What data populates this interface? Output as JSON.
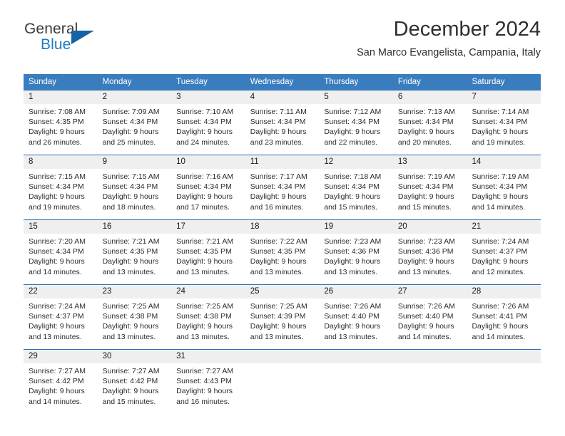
{
  "brand": {
    "name_top": "General",
    "name_bottom": "Blue",
    "accent_color": "#1464a5",
    "text_color": "#3b3b3b"
  },
  "header": {
    "title": "December 2024",
    "subtitle": "San Marco Evangelista, Campania, Italy"
  },
  "theme": {
    "header_blue": "#3a7dbf",
    "rule_blue": "#2a6db5",
    "date_band": "#efefef"
  },
  "calendar": {
    "weekdays": [
      "Sunday",
      "Monday",
      "Tuesday",
      "Wednesday",
      "Thursday",
      "Friday",
      "Saturday"
    ],
    "weeks": [
      [
        {
          "date": "1",
          "sunrise": "Sunrise: 7:08 AM",
          "sunset": "Sunset: 4:35 PM",
          "daylight1": "Daylight: 9 hours",
          "daylight2": "and 26 minutes."
        },
        {
          "date": "2",
          "sunrise": "Sunrise: 7:09 AM",
          "sunset": "Sunset: 4:34 PM",
          "daylight1": "Daylight: 9 hours",
          "daylight2": "and 25 minutes."
        },
        {
          "date": "3",
          "sunrise": "Sunrise: 7:10 AM",
          "sunset": "Sunset: 4:34 PM",
          "daylight1": "Daylight: 9 hours",
          "daylight2": "and 24 minutes."
        },
        {
          "date": "4",
          "sunrise": "Sunrise: 7:11 AM",
          "sunset": "Sunset: 4:34 PM",
          "daylight1": "Daylight: 9 hours",
          "daylight2": "and 23 minutes."
        },
        {
          "date": "5",
          "sunrise": "Sunrise: 7:12 AM",
          "sunset": "Sunset: 4:34 PM",
          "daylight1": "Daylight: 9 hours",
          "daylight2": "and 22 minutes."
        },
        {
          "date": "6",
          "sunrise": "Sunrise: 7:13 AM",
          "sunset": "Sunset: 4:34 PM",
          "daylight1": "Daylight: 9 hours",
          "daylight2": "and 20 minutes."
        },
        {
          "date": "7",
          "sunrise": "Sunrise: 7:14 AM",
          "sunset": "Sunset: 4:34 PM",
          "daylight1": "Daylight: 9 hours",
          "daylight2": "and 19 minutes."
        }
      ],
      [
        {
          "date": "8",
          "sunrise": "Sunrise: 7:15 AM",
          "sunset": "Sunset: 4:34 PM",
          "daylight1": "Daylight: 9 hours",
          "daylight2": "and 19 minutes."
        },
        {
          "date": "9",
          "sunrise": "Sunrise: 7:15 AM",
          "sunset": "Sunset: 4:34 PM",
          "daylight1": "Daylight: 9 hours",
          "daylight2": "and 18 minutes."
        },
        {
          "date": "10",
          "sunrise": "Sunrise: 7:16 AM",
          "sunset": "Sunset: 4:34 PM",
          "daylight1": "Daylight: 9 hours",
          "daylight2": "and 17 minutes."
        },
        {
          "date": "11",
          "sunrise": "Sunrise: 7:17 AM",
          "sunset": "Sunset: 4:34 PM",
          "daylight1": "Daylight: 9 hours",
          "daylight2": "and 16 minutes."
        },
        {
          "date": "12",
          "sunrise": "Sunrise: 7:18 AM",
          "sunset": "Sunset: 4:34 PM",
          "daylight1": "Daylight: 9 hours",
          "daylight2": "and 15 minutes."
        },
        {
          "date": "13",
          "sunrise": "Sunrise: 7:19 AM",
          "sunset": "Sunset: 4:34 PM",
          "daylight1": "Daylight: 9 hours",
          "daylight2": "and 15 minutes."
        },
        {
          "date": "14",
          "sunrise": "Sunrise: 7:19 AM",
          "sunset": "Sunset: 4:34 PM",
          "daylight1": "Daylight: 9 hours",
          "daylight2": "and 14 minutes."
        }
      ],
      [
        {
          "date": "15",
          "sunrise": "Sunrise: 7:20 AM",
          "sunset": "Sunset: 4:34 PM",
          "daylight1": "Daylight: 9 hours",
          "daylight2": "and 14 minutes."
        },
        {
          "date": "16",
          "sunrise": "Sunrise: 7:21 AM",
          "sunset": "Sunset: 4:35 PM",
          "daylight1": "Daylight: 9 hours",
          "daylight2": "and 13 minutes."
        },
        {
          "date": "17",
          "sunrise": "Sunrise: 7:21 AM",
          "sunset": "Sunset: 4:35 PM",
          "daylight1": "Daylight: 9 hours",
          "daylight2": "and 13 minutes."
        },
        {
          "date": "18",
          "sunrise": "Sunrise: 7:22 AM",
          "sunset": "Sunset: 4:35 PM",
          "daylight1": "Daylight: 9 hours",
          "daylight2": "and 13 minutes."
        },
        {
          "date": "19",
          "sunrise": "Sunrise: 7:23 AM",
          "sunset": "Sunset: 4:36 PM",
          "daylight1": "Daylight: 9 hours",
          "daylight2": "and 13 minutes."
        },
        {
          "date": "20",
          "sunrise": "Sunrise: 7:23 AM",
          "sunset": "Sunset: 4:36 PM",
          "daylight1": "Daylight: 9 hours",
          "daylight2": "and 13 minutes."
        },
        {
          "date": "21",
          "sunrise": "Sunrise: 7:24 AM",
          "sunset": "Sunset: 4:37 PM",
          "daylight1": "Daylight: 9 hours",
          "daylight2": "and 12 minutes."
        }
      ],
      [
        {
          "date": "22",
          "sunrise": "Sunrise: 7:24 AM",
          "sunset": "Sunset: 4:37 PM",
          "daylight1": "Daylight: 9 hours",
          "daylight2": "and 13 minutes."
        },
        {
          "date": "23",
          "sunrise": "Sunrise: 7:25 AM",
          "sunset": "Sunset: 4:38 PM",
          "daylight1": "Daylight: 9 hours",
          "daylight2": "and 13 minutes."
        },
        {
          "date": "24",
          "sunrise": "Sunrise: 7:25 AM",
          "sunset": "Sunset: 4:38 PM",
          "daylight1": "Daylight: 9 hours",
          "daylight2": "and 13 minutes."
        },
        {
          "date": "25",
          "sunrise": "Sunrise: 7:25 AM",
          "sunset": "Sunset: 4:39 PM",
          "daylight1": "Daylight: 9 hours",
          "daylight2": "and 13 minutes."
        },
        {
          "date": "26",
          "sunrise": "Sunrise: 7:26 AM",
          "sunset": "Sunset: 4:40 PM",
          "daylight1": "Daylight: 9 hours",
          "daylight2": "and 13 minutes."
        },
        {
          "date": "27",
          "sunrise": "Sunrise: 7:26 AM",
          "sunset": "Sunset: 4:40 PM",
          "daylight1": "Daylight: 9 hours",
          "daylight2": "and 14 minutes."
        },
        {
          "date": "28",
          "sunrise": "Sunrise: 7:26 AM",
          "sunset": "Sunset: 4:41 PM",
          "daylight1": "Daylight: 9 hours",
          "daylight2": "and 14 minutes."
        }
      ],
      [
        {
          "date": "29",
          "sunrise": "Sunrise: 7:27 AM",
          "sunset": "Sunset: 4:42 PM",
          "daylight1": "Daylight: 9 hours",
          "daylight2": "and 14 minutes."
        },
        {
          "date": "30",
          "sunrise": "Sunrise: 7:27 AM",
          "sunset": "Sunset: 4:42 PM",
          "daylight1": "Daylight: 9 hours",
          "daylight2": "and 15 minutes."
        },
        {
          "date": "31",
          "sunrise": "Sunrise: 7:27 AM",
          "sunset": "Sunset: 4:43 PM",
          "daylight1": "Daylight: 9 hours",
          "daylight2": "and 16 minutes."
        },
        {
          "date": "",
          "sunrise": "",
          "sunset": "",
          "daylight1": "",
          "daylight2": ""
        },
        {
          "date": "",
          "sunrise": "",
          "sunset": "",
          "daylight1": "",
          "daylight2": ""
        },
        {
          "date": "",
          "sunrise": "",
          "sunset": "",
          "daylight1": "",
          "daylight2": ""
        },
        {
          "date": "",
          "sunrise": "",
          "sunset": "",
          "daylight1": "",
          "daylight2": ""
        }
      ]
    ]
  }
}
